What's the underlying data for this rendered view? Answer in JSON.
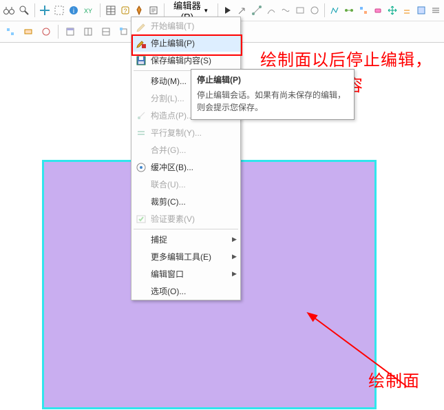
{
  "toolbars": {
    "row1_icons": [
      "binocular-icon",
      "zoom-tool-icon",
      "pan-icon",
      "selection-icon",
      "info-icon",
      "xy-coord-icon",
      "table-icon",
      "help-icon",
      "marker-icon",
      "script-icon"
    ],
    "editor_btn": "编辑器(R)",
    "row1_right_icons": [
      "arrow-start-icon",
      "arrow-icon",
      "vertex-line-icon",
      "arc-vertex-icon",
      "curve-icon",
      "rect-icon",
      "circle-icon",
      "polyline-icon",
      "sequence-icon",
      "topology-icon",
      "rubber-icon",
      "move-icon",
      "offset-icon",
      "box-icon",
      "more-icon"
    ],
    "row2_icons": [
      "tb2-a",
      "tb2-b",
      "tb2-c",
      "tb2-d",
      "tb2-e",
      "tb2-f",
      "tb2-g",
      "tb2-h",
      "tb2-i",
      "tb2-j",
      "tb2-k",
      "tb2-l",
      "tb2-m",
      "tb2-n"
    ]
  },
  "menu": {
    "items": [
      {
        "id": "start-edit",
        "label": "开始编辑(T)",
        "icon": "pencil-icon",
        "disabled": true
      },
      {
        "id": "stop-edit",
        "label": "停止编辑(P)",
        "icon": "pencil-stop-icon",
        "hover": true
      },
      {
        "id": "save-edit",
        "label": "保存编辑内容(S)",
        "icon": "save-icon"
      },
      {
        "sep": true
      },
      {
        "id": "move",
        "label": "移动(M)...",
        "submenu": true
      },
      {
        "id": "split",
        "label": "分割(L)...",
        "disabled": true
      },
      {
        "id": "construct",
        "label": "构造点(P)...",
        "icon": "construct-pt-icon",
        "disabled": true
      },
      {
        "id": "parallel",
        "label": "平行复制(Y)...",
        "icon": "parallel-icon",
        "disabled": true
      },
      {
        "id": "merge",
        "label": "合并(G)...",
        "disabled": true
      },
      {
        "id": "buffer",
        "label": "缓冲区(B)...",
        "icon": "buffer-icon"
      },
      {
        "id": "union",
        "label": "联合(U)...",
        "disabled": true
      },
      {
        "id": "clip",
        "label": "裁剪(C)...",
        "disabled": false
      },
      {
        "id": "validate",
        "label": "验证要素(V)",
        "icon": "validate-icon",
        "disabled": true
      },
      {
        "sep": true
      },
      {
        "id": "snap",
        "label": "捕捉",
        "submenu": true
      },
      {
        "id": "more-tools",
        "label": "更多编辑工具(E)",
        "submenu": true
      },
      {
        "id": "edit-win",
        "label": "编辑窗口",
        "submenu": true
      },
      {
        "id": "options",
        "label": "选项(O)..."
      }
    ]
  },
  "tooltip": {
    "title": "停止编辑(P)",
    "body": "停止编辑会话。如果有尚未保存的编辑，则会提示您保存。"
  },
  "annotations": {
    "top": "绘制面以后停止编辑，保存编辑内容",
    "bottom": "绘制面"
  },
  "colors": {
    "poly_fill": "#c9aef0",
    "poly_stroke": "#30e6ec",
    "highlight": "#ff0000",
    "anno": "#ff0000"
  }
}
